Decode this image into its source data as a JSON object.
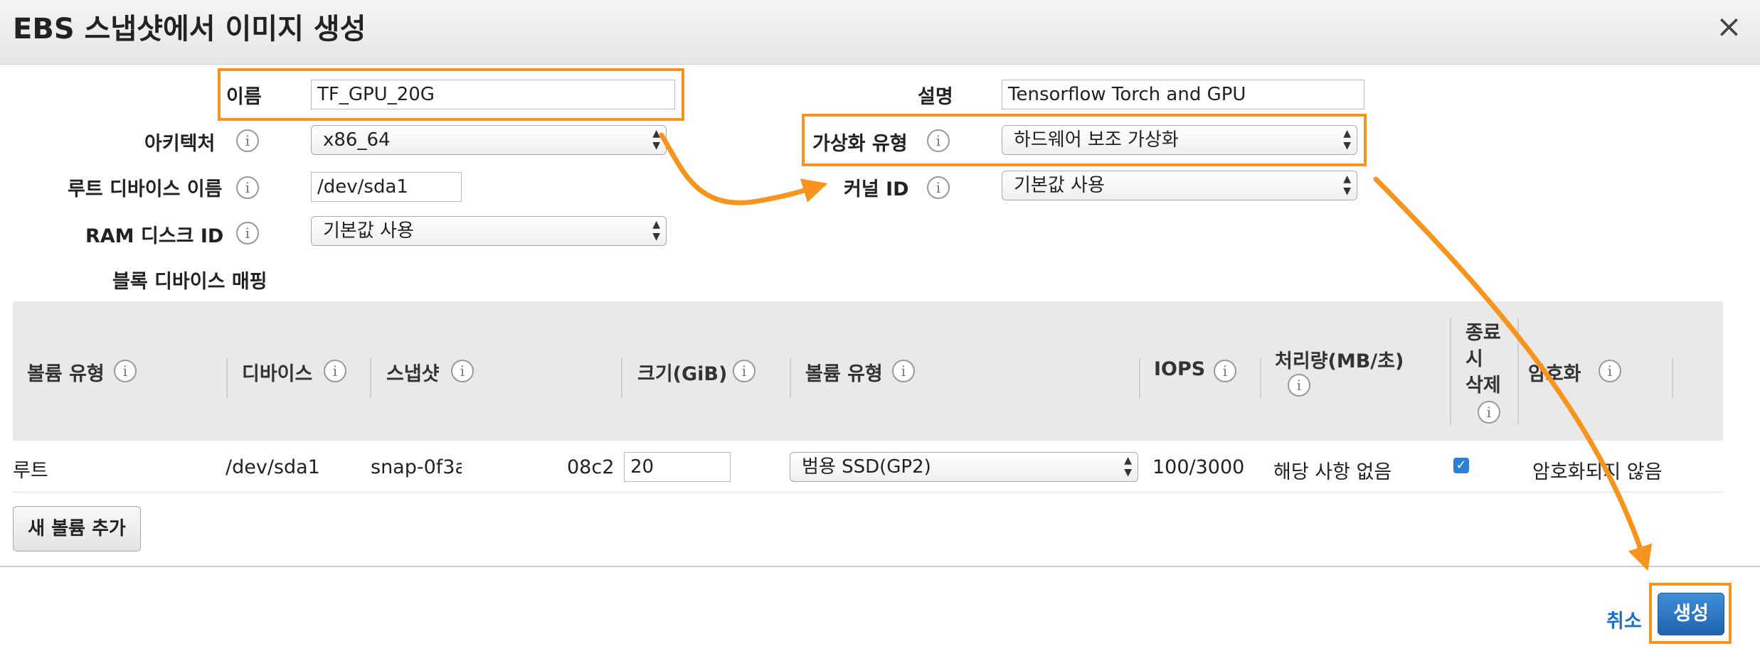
{
  "dialog": {
    "title": "EBS 스냅샷에서 이미지 생성",
    "close_glyph": "×"
  },
  "form": {
    "name_label": "이름",
    "name_value": "TF_GPU_20G",
    "description_label": "설명",
    "description_value": "Tensorflow Torch and GPU",
    "architecture_label": "아키텍처",
    "architecture_value": "x86_64",
    "virtualization_label": "가상화 유형",
    "virtualization_value": "하드웨어 보조 가상화",
    "root_device_label": "루트 디바이스 이름",
    "root_device_value": "/dev/sda1",
    "kernel_label": "커널 ID",
    "kernel_value": "기본값 사용",
    "ramdisk_label": "RAM 디스크 ID",
    "ramdisk_value": "기본값 사용",
    "block_mapping_label": "블록 디바이스 매핑"
  },
  "table": {
    "headers": {
      "volume_type": "볼륨 유형",
      "device": "디바이스",
      "snapshot": "스냅샷",
      "size": "크기(GiB)",
      "volume_kind": "볼륨 유형",
      "iops": "IOPS",
      "throughput": "처리량(MB/초)",
      "delete_line1": "종료",
      "delete_line2": "시",
      "delete_line3": "삭제",
      "encryption": "암호화"
    },
    "row": {
      "volume_type": "루트",
      "device": "/dev/sda1",
      "snapshot_start": "snap-0f3a",
      "snapshot_end": "08c2",
      "size": "20",
      "volume_kind": "범용 SSD(GP2)",
      "iops": "100/3000",
      "throughput": "해당 사항 없음",
      "delete_on_termination": true,
      "encryption": "암호화되지 않음"
    }
  },
  "buttons": {
    "add_volume": "새 볼륨 추가",
    "cancel": "취소",
    "create": "생성"
  },
  "colors": {
    "highlight": "#f7941d",
    "primary": "#1f62ad",
    "link": "#1a6fc4"
  },
  "icons": {
    "info": "info-icon",
    "close": "close-icon",
    "dropdown": "updown-arrows-icon",
    "check": "checkmark-icon"
  }
}
